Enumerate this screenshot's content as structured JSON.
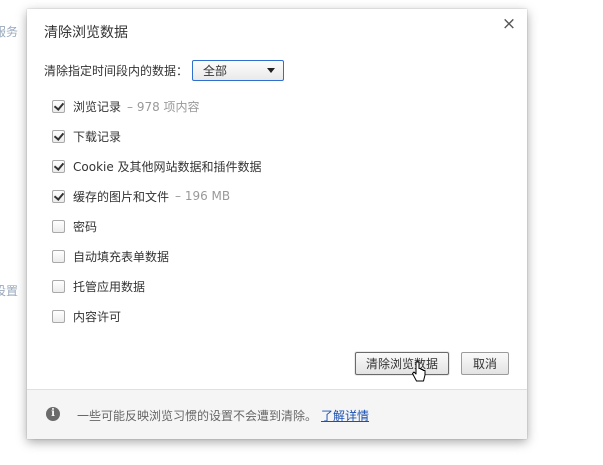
{
  "background": {
    "partial_text_1": "服务",
    "partial_text_2": "设置"
  },
  "dialog": {
    "title": "清除浏览数据",
    "close_glyph": "×",
    "time_range": {
      "label": "清除指定时间段内的数据：",
      "selected": "全部"
    },
    "options": [
      {
        "label": "浏览记录",
        "detail": "– 978 项内容",
        "checked": true
      },
      {
        "label": "下载记录",
        "detail": "",
        "checked": true
      },
      {
        "label": "Cookie 及其他网站数据和插件数据",
        "detail": "",
        "checked": true
      },
      {
        "label": "缓存的图片和文件",
        "detail": "– 196 MB",
        "checked": true
      },
      {
        "label": "密码",
        "detail": "",
        "checked": false
      },
      {
        "label": "自动填充表单数据",
        "detail": "",
        "checked": false
      },
      {
        "label": "托管应用数据",
        "detail": "",
        "checked": false
      },
      {
        "label": "内容许可",
        "detail": "",
        "checked": false
      }
    ],
    "buttons": {
      "clear_label": "清除浏览数据",
      "cancel_label": "取消"
    },
    "footer": {
      "icon": "info-icon",
      "icon_glyph": "i",
      "text": "一些可能反映浏览习惯的设置不会遭到清除。",
      "link": "了解详情"
    }
  },
  "colors": {
    "link": "#1a4fb3",
    "select_border": "#2f6fcf",
    "footer_bg": "#f5f5f5"
  }
}
